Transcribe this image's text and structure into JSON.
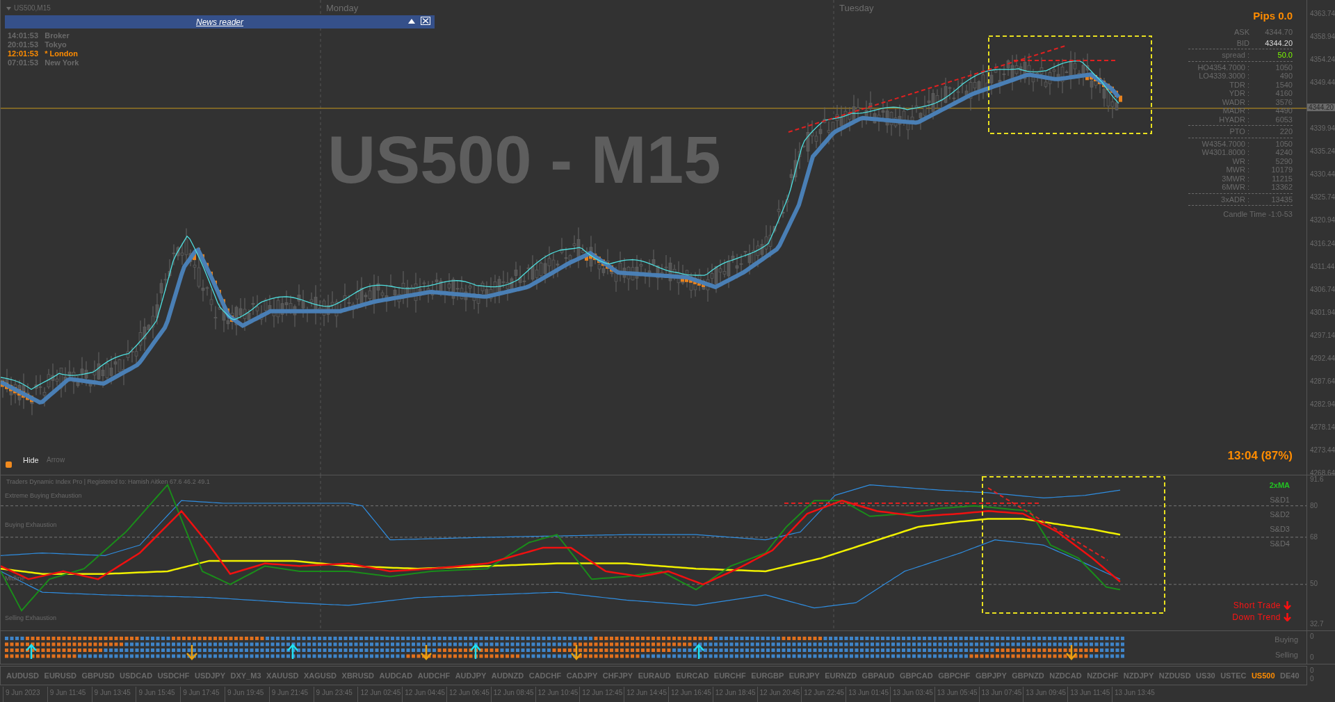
{
  "chart": {
    "symbol_timeframe": "US500,M15",
    "watermark": "US500 - M15",
    "days": [
      "Monday",
      "Tuesday"
    ],
    "pips": "Pips 0.0",
    "countdown": "13:04 (87%)",
    "current_price": "4344.20",
    "price_axis": [
      "4363.74",
      "4358.94",
      "4354.24",
      "4349.44",
      "4339.94",
      "4335.24",
      "4330.44",
      "4325.74",
      "4320.94",
      "4316.24",
      "4311.44",
      "4306.74",
      "4301.94",
      "4297.14",
      "4292.44",
      "4287.64",
      "4282.94",
      "4278.14",
      "4273.44",
      "4268.64"
    ]
  },
  "news_reader": {
    "title": "News reader"
  },
  "sessions": [
    {
      "time": "14:01:53",
      "name": "Broker",
      "selected": false
    },
    {
      "time": "20:01:53",
      "name": "Tokyo",
      "selected": false
    },
    {
      "time": "12:01:53",
      "name": "* London",
      "selected": true
    },
    {
      "time": "07:01:53",
      "name": "New York",
      "selected": false
    }
  ],
  "toggles": [
    {
      "label": "Hide",
      "selected": true
    },
    {
      "label": "Arrow",
      "selected": false
    }
  ],
  "info_panel": {
    "ask_label": "ASK",
    "ask": "4344.70",
    "bid_label": "BID",
    "bid": "4344.20",
    "spread": {
      "label": "spread :",
      "value": "50.0"
    },
    "groups": [
      [
        {
          "label": "HO4354.7000 :",
          "value": "1050"
        },
        {
          "label": "LO4339.3000 :",
          "value": "490"
        },
        {
          "label": "TDR :",
          "value": "1540"
        },
        {
          "label": "YDR :",
          "value": "4160"
        },
        {
          "label": "WADR :",
          "value": "3576"
        },
        {
          "label": "MADR :",
          "value": "4490"
        },
        {
          "label": "HYADR :",
          "value": "6053"
        }
      ],
      [
        {
          "label": "PTO :",
          "value": "220"
        }
      ],
      [
        {
          "label": "W4354.7000 :",
          "value": "1050"
        },
        {
          "label": "W4301.8000 :",
          "value": "4240"
        },
        {
          "label": "WR :",
          "value": "5290"
        },
        {
          "label": "MWR :",
          "value": "10179"
        },
        {
          "label": "3MWR :",
          "value": "11215"
        },
        {
          "label": "6MWR :",
          "value": "13362"
        }
      ],
      [
        {
          "label": "3xADR :",
          "value": "13435"
        }
      ]
    ],
    "candle_time": "Candle Time -1:0-53"
  },
  "indicator": {
    "title": "Traders Dynamic Index Pro | Registered to: Hamish Aitken 67.6 46.2 49.1",
    "levels": [
      "Extreme Buying Exhaustion",
      "Buying Exhaustion",
      "Midline",
      "Selling Exhaustion"
    ],
    "axis": [
      "91.6",
      "80",
      "68",
      "50",
      "32.7"
    ],
    "legend": [
      {
        "label": "2xMA",
        "color": "#22c322"
      },
      {
        "label": "S&D1",
        "color": "#6e6e6e"
      },
      {
        "label": "S&D2",
        "color": "#6e6e6e"
      },
      {
        "label": "S&D3",
        "color": "#6e6e6e"
      },
      {
        "label": "S&D4",
        "color": "#6e6e6e"
      }
    ],
    "signals": [
      "Short Trade",
      "Down Trend"
    ]
  },
  "signal_panel": {
    "labels": [
      "Buying",
      "Selling"
    ],
    "axis": [
      "0",
      "0"
    ]
  },
  "symbols": [
    {
      "label": "AUDUSD",
      "selected": false
    },
    {
      "label": "EURUSD",
      "selected": false
    },
    {
      "label": "GBPUSD",
      "selected": false
    },
    {
      "label": "USDCAD",
      "selected": false
    },
    {
      "label": "USDCHF",
      "selected": false
    },
    {
      "label": "USDJPY",
      "selected": false
    },
    {
      "label": "DXY_M3",
      "selected": false
    },
    {
      "label": "XAUUSD",
      "selected": false
    },
    {
      "label": "XAGUSD",
      "selected": false
    },
    {
      "label": "XBRUSD",
      "selected": false
    },
    {
      "label": "AUDCAD",
      "selected": false
    },
    {
      "label": "AUDCHF",
      "selected": false
    },
    {
      "label": "AUDJPY",
      "selected": false
    },
    {
      "label": "AUDNZD",
      "selected": false
    },
    {
      "label": "CADCHF",
      "selected": false
    },
    {
      "label": "CADJPY",
      "selected": false
    },
    {
      "label": "CHFJPY",
      "selected": false
    },
    {
      "label": "EURAUD",
      "selected": false
    },
    {
      "label": "EURCAD",
      "selected": false
    },
    {
      "label": "EURCHF",
      "selected": false
    },
    {
      "label": "EURGBP",
      "selected": false
    },
    {
      "label": "EURJPY",
      "selected": false
    },
    {
      "label": "EURNZD",
      "selected": false
    },
    {
      "label": "GBPAUD",
      "selected": false
    },
    {
      "label": "GBPCAD",
      "selected": false
    },
    {
      "label": "GBPCHF",
      "selected": false
    },
    {
      "label": "GBPJPY",
      "selected": false
    },
    {
      "label": "GBPNZD",
      "selected": false
    },
    {
      "label": "NZDCAD",
      "selected": false
    },
    {
      "label": "NZDCHF",
      "selected": false
    },
    {
      "label": "NZDJPY",
      "selected": false
    },
    {
      "label": "NZDUSD",
      "selected": false
    },
    {
      "label": "US30",
      "selected": false
    },
    {
      "label": "USTEC",
      "selected": false
    },
    {
      "label": "US500",
      "selected": true
    },
    {
      "label": "DE40",
      "selected": false
    }
  ],
  "symbol_axis": [
    "0",
    "0"
  ],
  "time_axis": [
    "9 Jun 2023",
    "9 Jun 11:45",
    "9 Jun 13:45",
    "9 Jun 15:45",
    "9 Jun 17:45",
    "9 Jun 19:45",
    "9 Jun 21:45",
    "9 Jun 23:45",
    "12 Jun 02:45",
    "12 Jun 04:45",
    "12 Jun 06:45",
    "12 Jun 08:45",
    "12 Jun 10:45",
    "12 Jun 12:45",
    "12 Jun 14:45",
    "12 Jun 16:45",
    "12 Jun 18:45",
    "12 Jun 20:45",
    "12 Jun 22:45",
    "13 Jun 01:45",
    "13 Jun 03:45",
    "13 Jun 05:45",
    "13 Jun 07:45",
    "13 Jun 09:45",
    "13 Jun 11:45",
    "13 Jun 13:45"
  ]
}
